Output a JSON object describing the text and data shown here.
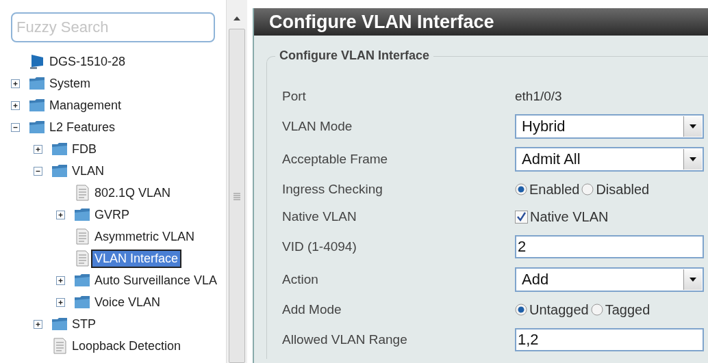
{
  "sidebar": {
    "search": {
      "placeholder": "Fuzzy Search"
    },
    "tree": [
      {
        "label": "DGS-1510-28",
        "kind": "device",
        "selected": false
      },
      {
        "label": "System",
        "kind": "folder",
        "expanded": false,
        "selected": false
      },
      {
        "label": "Management",
        "kind": "folder",
        "expanded": false,
        "selected": false
      },
      {
        "label": "L2 Features",
        "kind": "folder",
        "expanded": true,
        "selected": false,
        "children": [
          {
            "label": "FDB",
            "kind": "folder",
            "expanded": false,
            "selected": false
          },
          {
            "label": "VLAN",
            "kind": "folder",
            "expanded": true,
            "selected": false,
            "children": [
              {
                "label": "802.1Q VLAN",
                "kind": "page",
                "selected": false
              },
              {
                "label": "GVRP",
                "kind": "folder",
                "expanded": false,
                "selected": false
              },
              {
                "label": "Asymmetric VLAN",
                "kind": "page",
                "selected": false
              },
              {
                "label": "VLAN Interface",
                "kind": "page",
                "selected": true
              },
              {
                "label": "Auto Surveillance VLA",
                "kind": "folder",
                "expanded": false,
                "selected": false
              },
              {
                "label": "Voice VLAN",
                "kind": "folder",
                "expanded": false,
                "selected": false
              }
            ]
          },
          {
            "label": "STP",
            "kind": "folder",
            "expanded": false,
            "selected": false
          },
          {
            "label": "Loopback Detection",
            "kind": "page",
            "selected": false
          }
        ]
      }
    ]
  },
  "panel": {
    "title": "Configure VLAN Interface",
    "section": "Configure VLAN Interface",
    "fields": [
      {
        "label": "Port",
        "kind": "text",
        "value": "eth1/0/3"
      },
      {
        "label": "VLAN Mode",
        "kind": "select",
        "value": "Hybrid"
      },
      {
        "label": "Acceptable Frame",
        "kind": "select",
        "value": "Admit All"
      },
      {
        "label": "Ingress Checking",
        "kind": "radio",
        "options": [
          {
            "label": "Enabled",
            "selected": true
          },
          {
            "label": "Disabled",
            "selected": false
          }
        ]
      },
      {
        "label": "Native VLAN",
        "kind": "checkbox",
        "option": "Native VLAN",
        "checked": true
      },
      {
        "label": "VID (1-4094)",
        "kind": "input",
        "value": "2"
      },
      {
        "label": "Action",
        "kind": "select",
        "value": "Add"
      },
      {
        "label": "Add Mode",
        "kind": "radio",
        "options": [
          {
            "label": "Untagged",
            "selected": true
          },
          {
            "label": "Tagged",
            "selected": false
          }
        ]
      },
      {
        "label": "Allowed VLAN Range",
        "kind": "input",
        "value": "1,2"
      }
    ]
  }
}
